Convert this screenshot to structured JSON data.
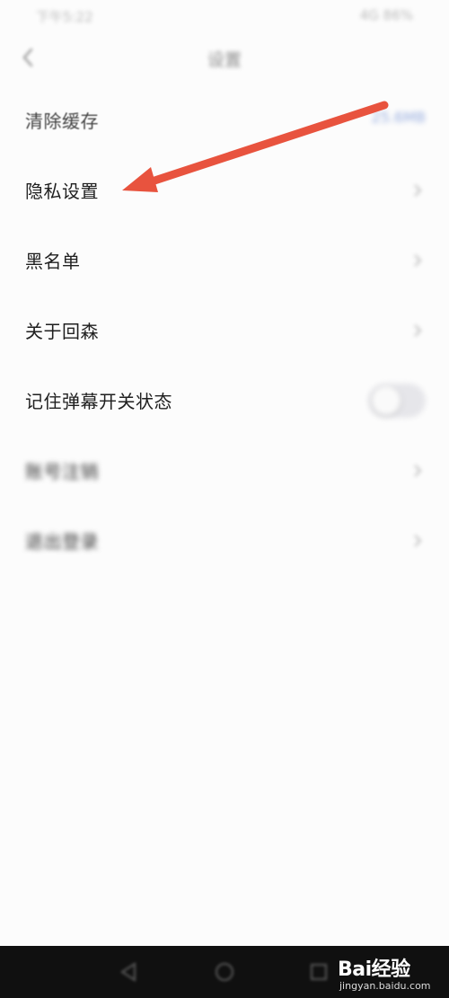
{
  "status_bar": {
    "left_text": "下午5:22",
    "right_text": "4G 86%"
  },
  "nav": {
    "title": "设置",
    "back_icon": "back-chevron-icon"
  },
  "settings": {
    "clear_cache": {
      "label": "清除缓存",
      "value": "25.6MB"
    },
    "privacy": {
      "label": "隐私设置"
    },
    "blacklist": {
      "label": "黑名单"
    },
    "about": {
      "label": "关于回森"
    },
    "danmaku_state": {
      "label": "记住弹幕开关状态",
      "toggle_on": false
    },
    "account_cancel": {
      "label": "账号注销"
    },
    "logout": {
      "label": "退出登录"
    }
  },
  "annotation": {
    "arrow_color": "#e8533e"
  },
  "watermark": {
    "logo": "Bai经验",
    "site": "jingyan.baidu.com"
  }
}
